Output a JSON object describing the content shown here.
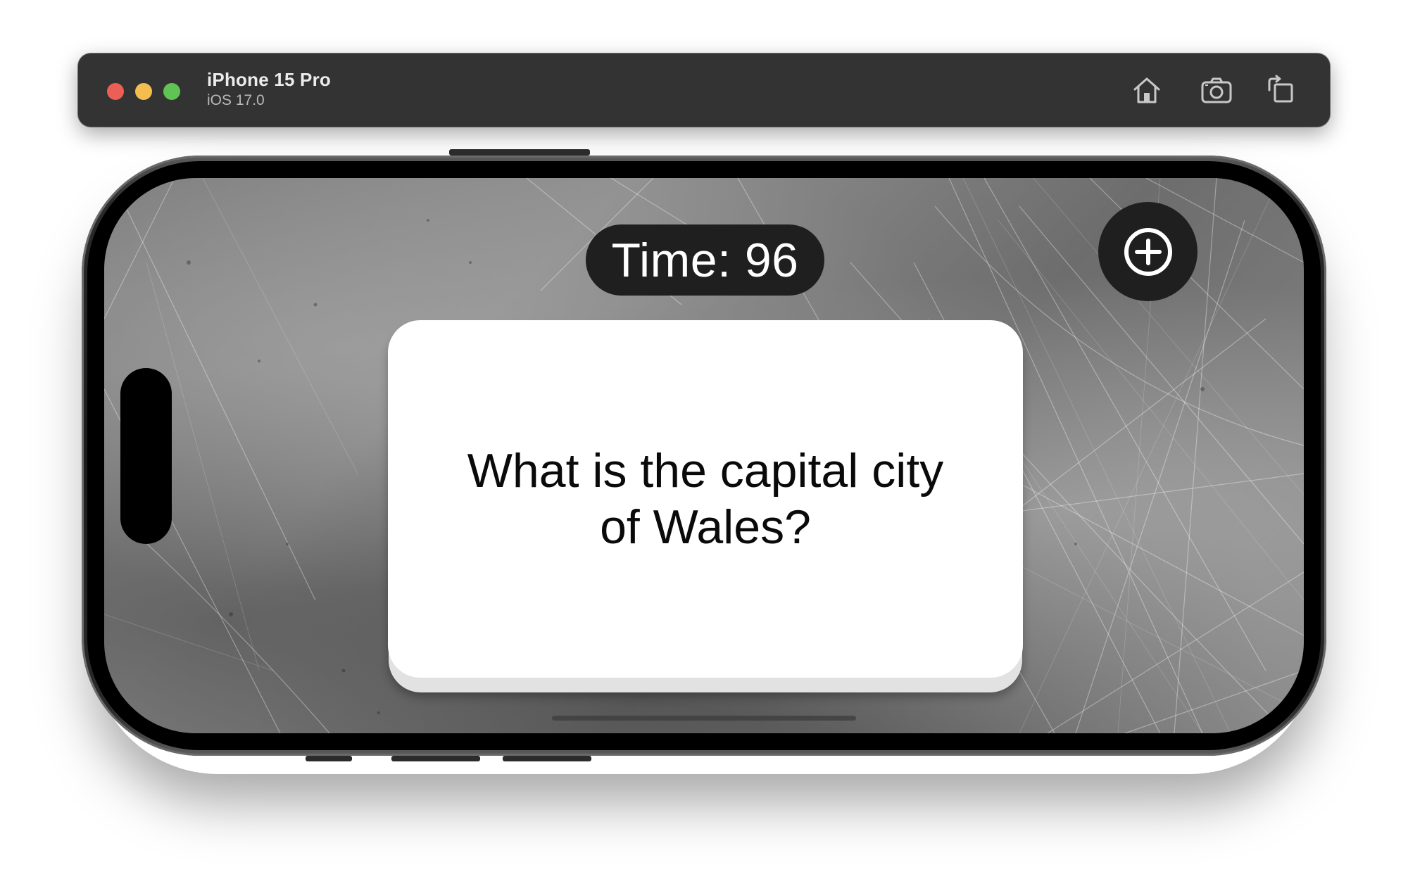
{
  "simulator": {
    "device_name": "iPhone 15 Pro",
    "os_version": "iOS 17.0",
    "toolbar_icons": [
      "home-icon",
      "screenshot-icon",
      "rotate-icon"
    ]
  },
  "app": {
    "timer_text": "Time: 96",
    "add_button_icon": "plus-circle-icon",
    "card_question": "What is the capital city of Wales?"
  },
  "colors": {
    "toolbar_bg": "#333333",
    "traffic_red": "#ec5f57",
    "traffic_yellow": "#f3be4f",
    "traffic_green": "#5fc453",
    "pill_bg": "#1f1f1f",
    "card_bg": "#ffffff"
  }
}
